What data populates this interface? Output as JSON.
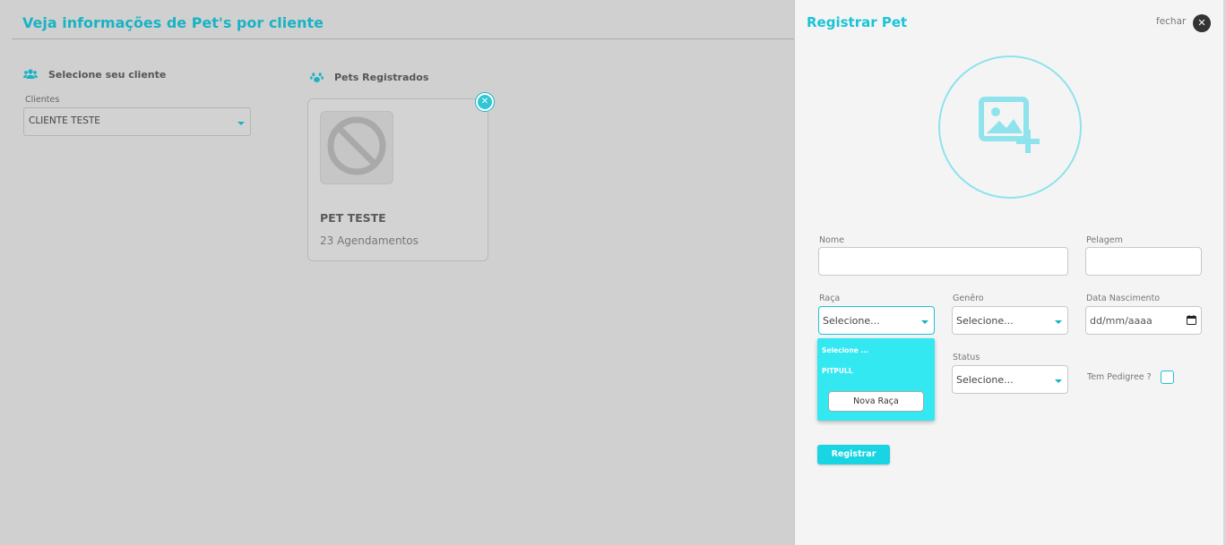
{
  "page": {
    "title": "Veja informações de Pet's por cliente",
    "client_section": {
      "heading": "Selecione seu cliente",
      "icon": "users-icon",
      "clients_label": "Clientes",
      "clients_value": "CLIENTE TESTE"
    },
    "pets_section": {
      "heading": "Pets Registrados",
      "icon": "paw-icon",
      "pets": [
        {
          "name": "PET TESTE",
          "appointments": "23 Agendamentos",
          "photo_icon": "no-image-icon"
        }
      ]
    }
  },
  "panel": {
    "title": "Registrar Pet",
    "close_label": "fechar",
    "close_icon": "close-icon",
    "photo_icon": "add-image-icon",
    "fields": {
      "nome": {
        "label": "Nome",
        "value": ""
      },
      "pelagem": {
        "label": "Pelagem",
        "value": ""
      },
      "raca": {
        "label": "Raça",
        "value": "Selecione..."
      },
      "genero": {
        "label": "Genêro",
        "value": "Selecione..."
      },
      "data_nascimento": {
        "label": "Data Nascimento",
        "value": "dd/mm/aaaa"
      },
      "status": {
        "label": "Status",
        "value": "Selecione..."
      },
      "pedigree": {
        "label": "Tem Pedigree ?",
        "checked": false
      }
    },
    "raca_dropdown": {
      "options": [
        "Selecione ...",
        "PITPULL"
      ],
      "new_button": "Nova Raça"
    },
    "register_button": "Registrar"
  },
  "colors": {
    "accent": "#19c4d6",
    "dropdown": "#34e8f2",
    "overlay": "#d0d0d0"
  }
}
